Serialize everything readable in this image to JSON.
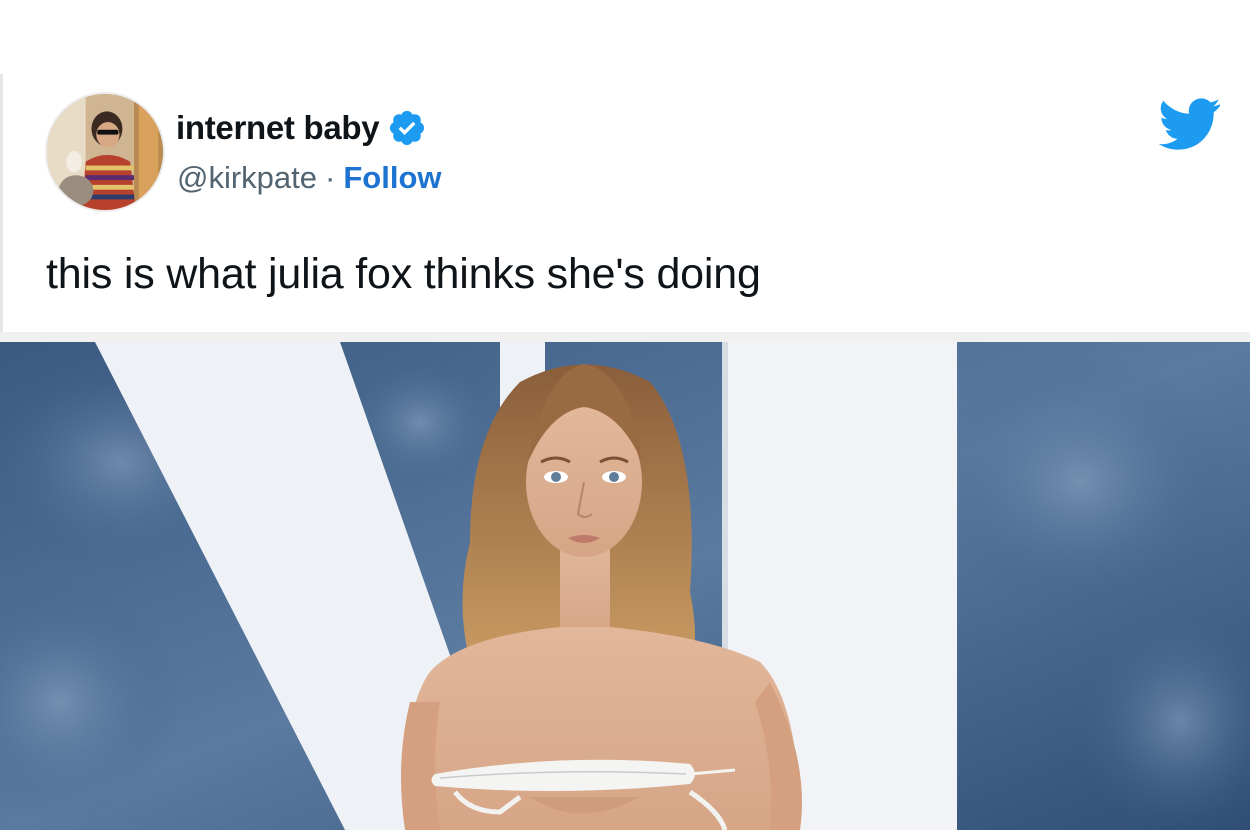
{
  "tweet": {
    "display_name": "internet baby",
    "handle": "@kirkpate",
    "separator": "·",
    "follow_label": "Follow",
    "text": "this is what julia fox thinks she's doing"
  },
  "icons": {
    "verified": "verified-badge-icon",
    "brand": "twitter-bird-icon"
  },
  "colors": {
    "follow_link": "#1d74d0",
    "verified_badge": "#1d9bf0",
    "twitter_logo": "#1d9bf0",
    "backdrop_blue": "#3e5f86"
  }
}
